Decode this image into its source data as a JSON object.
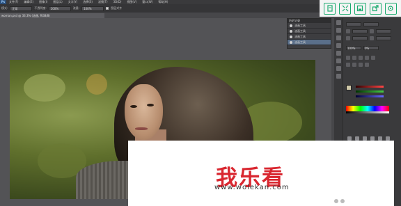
{
  "app": {
    "logo": "Ps"
  },
  "menu": [
    "文件(F)",
    "编辑(E)",
    "图像(I)",
    "图层(L)",
    "文字(Y)",
    "选择(S)",
    "滤镜(T)",
    "3D(D)",
    "视图(V)",
    "窗口(W)",
    "帮助(H)"
  ],
  "options": {
    "mode_label": "模式:",
    "mode_value": "正常",
    "opacity_label": "不透明度:",
    "opacity_value": "100%",
    "flow_label": "流量:",
    "flow_value": "100%",
    "check_label": "图层对齐"
  },
  "document_tab": "woman.psd @ 33.3% (油画, RGB/8)",
  "layers": {
    "title": "历史记录",
    "rows": [
      "油画工具",
      "油画工具",
      "油画工具",
      "油画工具"
    ]
  },
  "properties": {
    "field1": "100%",
    "field2": "0%"
  },
  "watermark": {
    "title": "我乐看",
    "url": "www.wolekan.com"
  },
  "float_toolbar": {
    "icons": [
      "bookmark-icon",
      "expand-icon",
      "save-icon",
      "share-icon",
      "settings-icon"
    ],
    "accent": "#1aaa6e"
  }
}
